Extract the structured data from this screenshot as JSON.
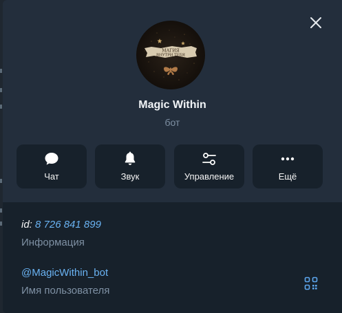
{
  "profile": {
    "name": "Magic Within",
    "type_label": "бот",
    "avatar_text_line1": "МАГИЯ",
    "avatar_text_line2": "ВНУТРИ ТЕБЯ"
  },
  "actions": [
    {
      "label": "Чат",
      "icon": "chat-bubble-icon"
    },
    {
      "label": "Звук",
      "icon": "bell-icon"
    },
    {
      "label": "Управление",
      "icon": "sliders-icon"
    },
    {
      "label": "Ещё",
      "icon": "more-dots-icon"
    }
  ],
  "info": {
    "id_prefix": "id:",
    "id_value": "8 726 841 899",
    "id_caption": "Информация",
    "username": "@MagicWithin_bot",
    "username_caption": "Имя пользователя"
  },
  "colors": {
    "panel_bg": "#17212b",
    "header_bg": "#232e3c",
    "link": "#6ab3f3",
    "muted": "#7f91a4",
    "accent": "#5ea8f0"
  }
}
